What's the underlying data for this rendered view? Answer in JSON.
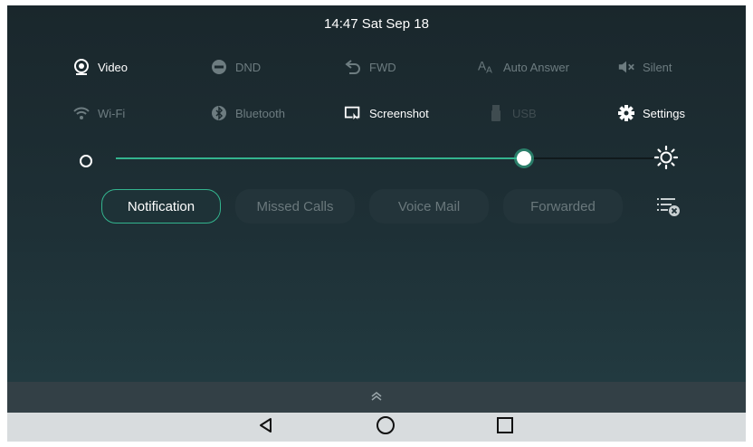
{
  "status": {
    "clock": "14:47 Sat Sep 18"
  },
  "quick_settings": {
    "row1": [
      {
        "label": "Video",
        "icon": "video-icon",
        "state": "on"
      },
      {
        "label": "DND",
        "icon": "dnd-icon",
        "state": "off"
      },
      {
        "label": "FWD",
        "icon": "forward-icon",
        "state": "off"
      },
      {
        "label": "Auto Answer",
        "icon": "auto-answer-icon",
        "state": "off"
      },
      {
        "label": "Silent",
        "icon": "silent-icon",
        "state": "off"
      }
    ],
    "row2": [
      {
        "label": "Wi-Fi",
        "icon": "wifi-icon",
        "state": "off"
      },
      {
        "label": "Bluetooth",
        "icon": "bluetooth-icon",
        "state": "off"
      },
      {
        "label": "Screenshot",
        "icon": "screenshot-icon",
        "state": "on"
      },
      {
        "label": "USB",
        "icon": "usb-icon",
        "state": "disabled"
      },
      {
        "label": "Settings",
        "icon": "gear-icon",
        "state": "on"
      }
    ]
  },
  "brightness": {
    "level_percent": 76,
    "accent": "#33b48e"
  },
  "notification_tabs": [
    {
      "label": "Notification",
      "active": true
    },
    {
      "label": "Missed Calls",
      "active": false
    },
    {
      "label": "Voice Mail",
      "active": false
    },
    {
      "label": "Forwarded",
      "active": false
    }
  ],
  "navigation": {
    "buttons": [
      "back-icon",
      "home-icon",
      "recents-icon"
    ]
  }
}
